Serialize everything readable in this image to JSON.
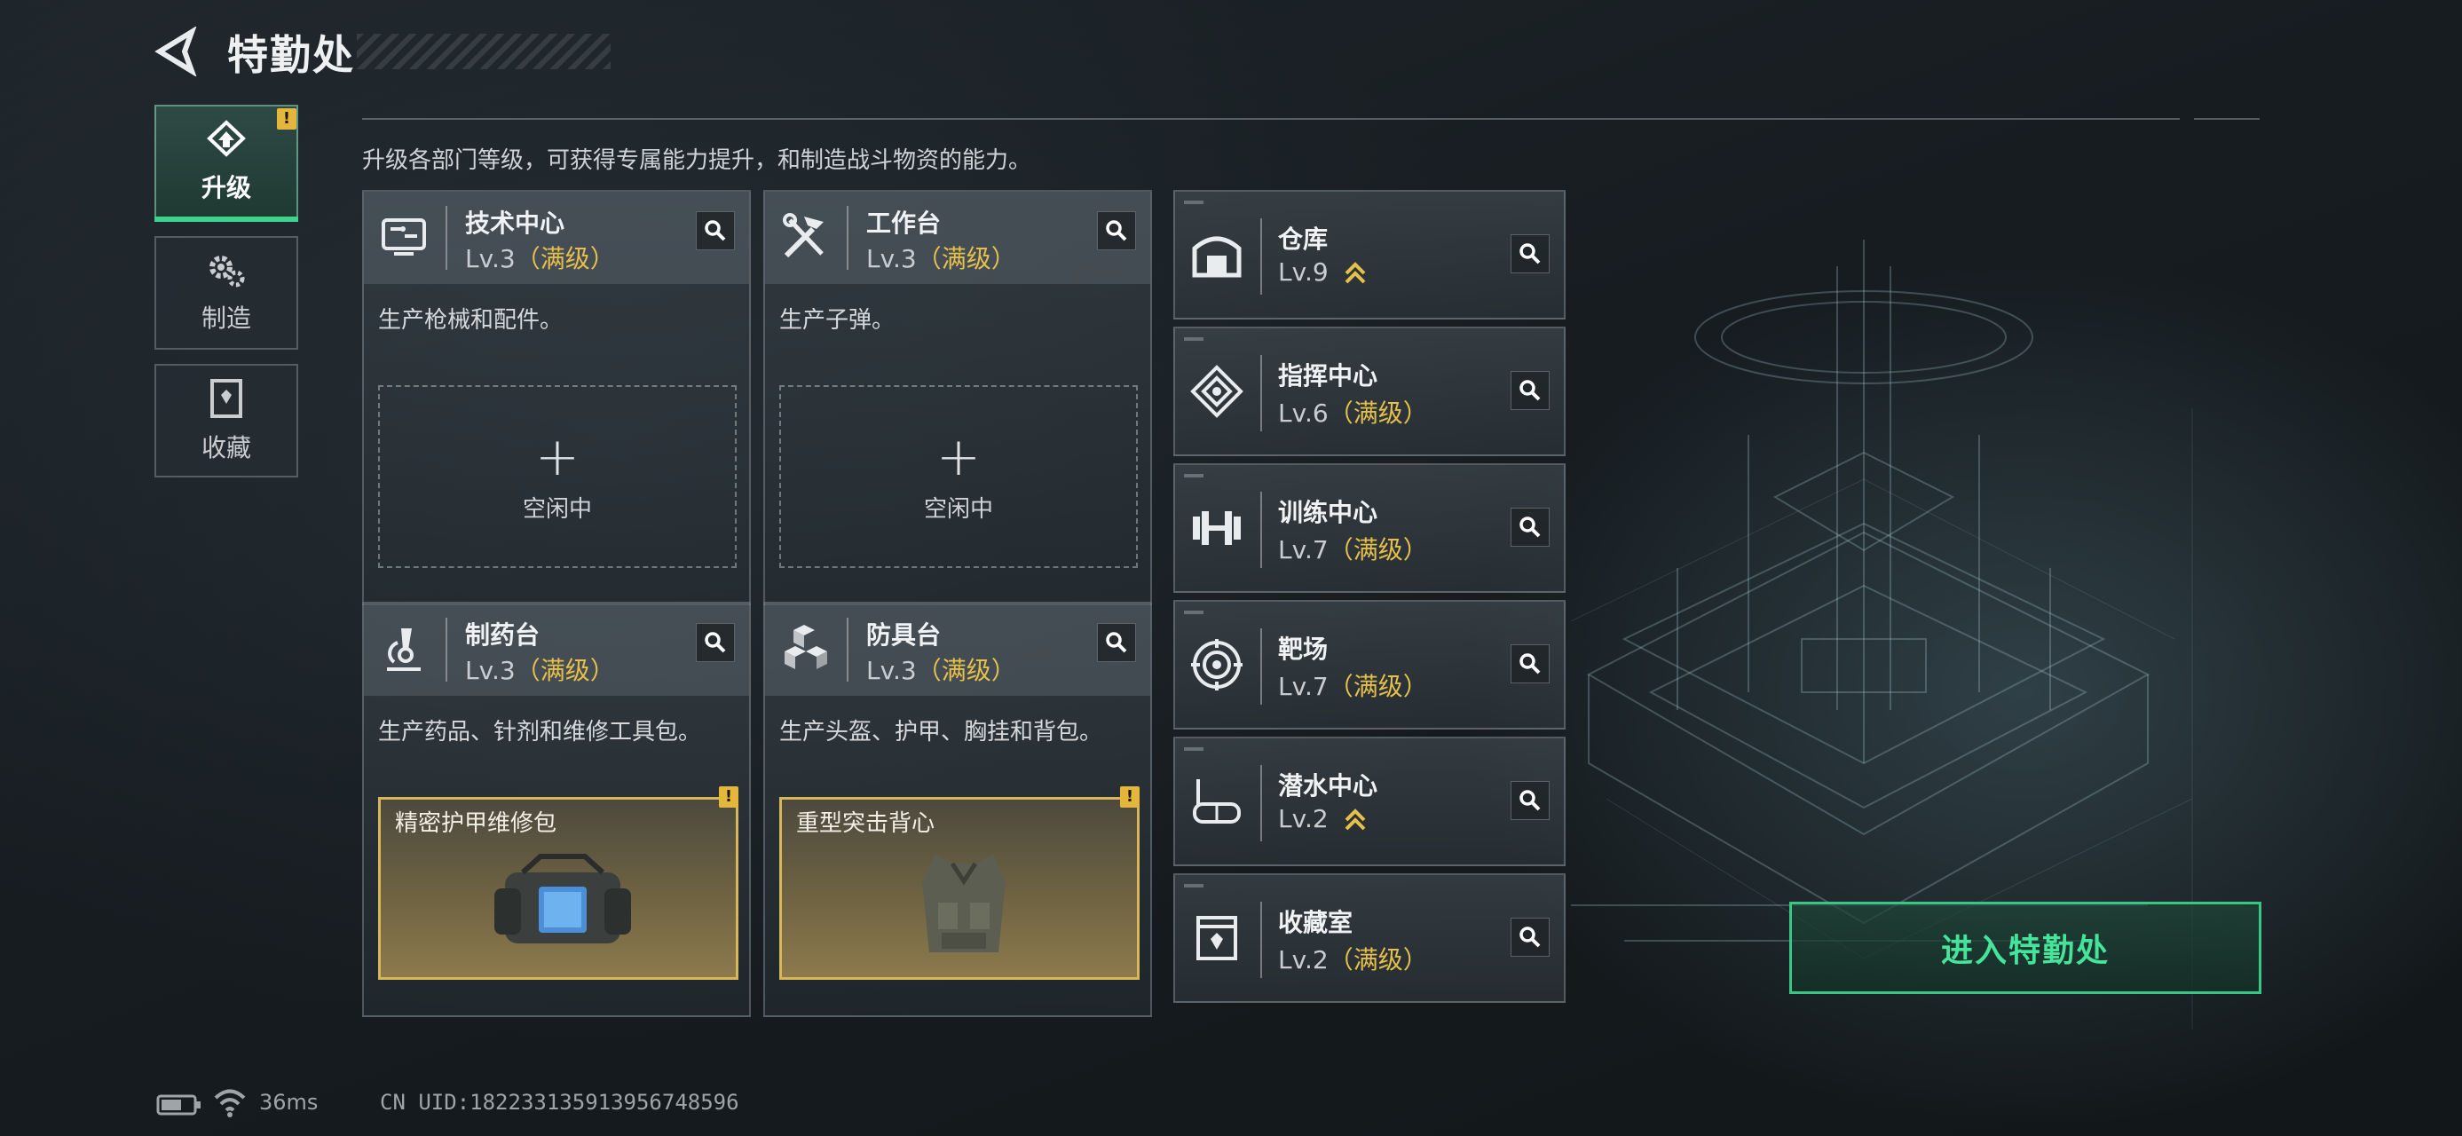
{
  "header": {
    "title": "特勤处",
    "subtitle": "升级各部门等级，可获得专属能力提升，和制造战斗物资的能力。"
  },
  "sidebar": {
    "tabs": [
      {
        "label": "升级",
        "icon": "upgrade-icon",
        "active": true,
        "alert": "!"
      },
      {
        "label": "制造",
        "icon": "gears-icon",
        "active": false
      },
      {
        "label": "收藏",
        "icon": "collection-icon",
        "active": false
      }
    ]
  },
  "stations": [
    {
      "name": "技术中心",
      "level": "Lv.3",
      "status": "（满级）",
      "desc": "生产枪械和配件。",
      "slot_state": "空闲中",
      "icon": "tech-center-icon"
    },
    {
      "name": "工作台",
      "level": "Lv.3",
      "status": "（满级）",
      "desc": "生产子弹。",
      "slot_state": "空闲中",
      "icon": "workbench-tools-icon"
    },
    {
      "name": "制药台",
      "level": "Lv.3",
      "status": "（满级）",
      "desc": "生产药品、针剂和维修工具包。",
      "item": "精密护甲维修包",
      "alert": "!",
      "icon": "microscope-icon"
    },
    {
      "name": "防具台",
      "level": "Lv.3",
      "status": "（满级）",
      "desc": "生产头盔、护甲、胸挂和背包。",
      "item": "重型突击背心",
      "alert": "!",
      "icon": "armor-cubes-icon"
    }
  ],
  "facilities": [
    {
      "name": "仓库",
      "level": "Lv.9",
      "status": "",
      "upgradable": true,
      "icon": "warehouse-icon"
    },
    {
      "name": "指挥中心",
      "level": "Lv.6",
      "status": "（满级）",
      "upgradable": false,
      "icon": "command-center-icon"
    },
    {
      "name": "训练中心",
      "level": "Lv.7",
      "status": "（满级）",
      "upgradable": false,
      "icon": "dumbbell-icon"
    },
    {
      "name": "靶场",
      "level": "Lv.7",
      "status": "（满级）",
      "upgradable": false,
      "icon": "target-icon"
    },
    {
      "name": "潜水中心",
      "level": "Lv.2",
      "status": "",
      "upgradable": true,
      "icon": "dive-mask-icon"
    },
    {
      "name": "收藏室",
      "level": "Lv.2",
      "status": "（满级）",
      "upgradable": false,
      "icon": "collection-room-icon"
    }
  ],
  "enter_button": {
    "label": "进入特勤处"
  },
  "footer": {
    "ping": "36ms",
    "uid": "CN UID:1822331359139567485​96"
  },
  "colors": {
    "accent_green": "#3ed38d",
    "maxed_gold": "#e6c04a",
    "alert_yellow": "#e4b73c"
  }
}
